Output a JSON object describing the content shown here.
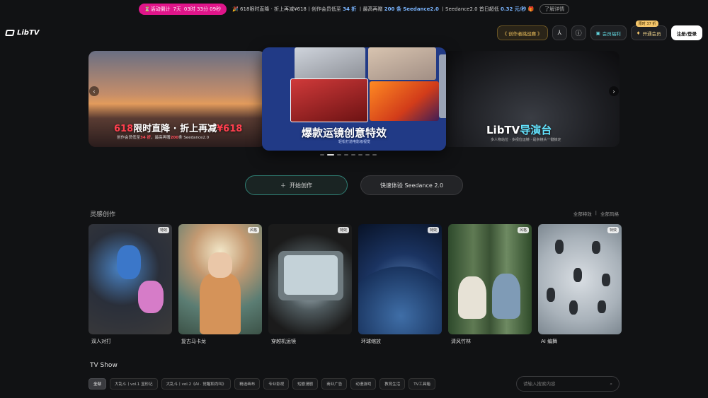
{
  "banner": {
    "promo_label": "⏳活动倒计",
    "countdown_days": "7天",
    "countdown_time": "03时 33分 09秒",
    "msg_part1": "🎉 618限时直降 · 折上再减¥618丨创作会员低至",
    "msg_hl1": "34 折",
    "msg_part2": "丨最高再赠",
    "msg_hl2": "200 条 Seedance2.0",
    "msg_part3": "丨Seedance2.0 首日超低",
    "msg_hl3": "0.32 元/秒",
    "gift": "🎁",
    "more_label": "了解详情"
  },
  "header": {
    "logo_text": "LibTV",
    "creator_contest": "《 创作者挑战赛 》",
    "assets_label": "会员福利",
    "vip_badge": "限时 37 折",
    "vip_label": "开通会员",
    "login_label": "注册/登录"
  },
  "carousel": {
    "left_caption_red": "618",
    "left_caption_white": "限时直降 · 折上再减",
    "left_caption_red2": "¥618",
    "left_sub_1": "创作会员低至",
    "left_sub_hl1": "34 折",
    "left_sub_2": "，最高再赠",
    "left_sub_hl2": "200",
    "left_sub_3": "条 Seedance2.0",
    "center_caption": "爆款运镜创意特效",
    "center_sub": "轻松打造电影级视觉",
    "right_caption_white": "LibTV",
    "right_caption_cyan": "导演台",
    "right_sub": "多人物站位 · 多视位运镜 · 是杂镜头一键搞定",
    "prev_arrow": "‹",
    "next_arrow": "›"
  },
  "cta": {
    "create_label": "开始创作",
    "try_label": "快速体验 Seedance 2.0"
  },
  "inspiration": {
    "title": "灵感创作",
    "link_all_effects": "全部特效",
    "link_all_styles": "全部风格",
    "cards": [
      {
        "tag": "特效",
        "title": "双人对打"
      },
      {
        "tag": "风格",
        "title": "复古马卡龙"
      },
      {
        "tag": "特效",
        "title": "穿越机运镜"
      },
      {
        "tag": "特效",
        "title": "环球缩放"
      },
      {
        "tag": "风格",
        "title": "清风竹林"
      },
      {
        "tag": "特效",
        "title": "AI 编舞"
      }
    ]
  },
  "tvshow": {
    "title": "TV Show",
    "chips": [
      "全部",
      "大乱斗丨vol.1 显形记",
      "大乱斗丨vol.2《AI · 觉醒和尚叫》",
      "精选画布",
      "专业影视",
      "短剧漫剧",
      "商业广告",
      "动漫游戏",
      "教育生活",
      "TV工具箱"
    ],
    "search_placeholder": "请输入搜索内容"
  }
}
